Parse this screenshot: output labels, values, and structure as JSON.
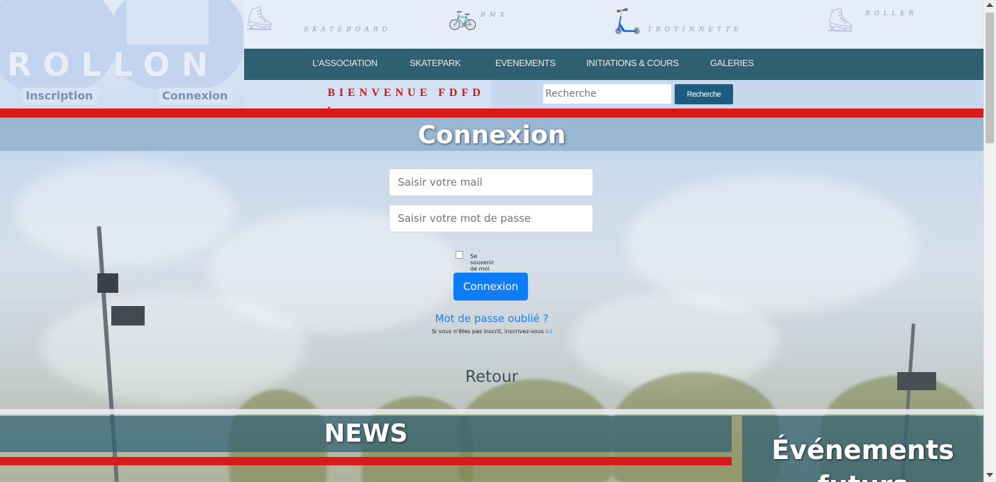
{
  "header": {
    "logo_text": "ROLLON",
    "inscription_label": "Inscription",
    "connexion_label": "Connexion"
  },
  "sports": {
    "skateboard": "SKATEBOARD",
    "bmx": "BMX",
    "trotinnette": "TROTINNETTE",
    "roller": "ROLLER"
  },
  "nav": {
    "items": [
      "L'ASSOCIATION",
      "SKATEPARK",
      "EVENEMENTS",
      "INITIATIONS & COURS",
      "GALERIES"
    ]
  },
  "welcome": {
    "text": "BIENVENUE FDFD ."
  },
  "search": {
    "placeholder": "Recherche",
    "button_label": "Recherche"
  },
  "login": {
    "title": "Connexion",
    "email_placeholder": "Saisir votre mail",
    "password_placeholder": "Saisir votre mot de passe",
    "remember_label": "Se souvenir de moi",
    "remember_checked": false,
    "submit_label": "Connexion",
    "forgot_label": "Mot de passe oublié ?",
    "register_text": "Si vous n'êtes pas inscrit, inscrivez-vous",
    "register_link": "ici",
    "back_label": "Retour"
  },
  "sections": {
    "news_title": "NEWS",
    "events_title_line1": "Événements",
    "events_title_line2": "futurs"
  },
  "colors": {
    "nav_bg": "#2e6072",
    "accent_red": "#d81a1a",
    "primary_button": "#0d7cf6",
    "search_button": "#1d5c7e",
    "welcome_text": "#c11b1b"
  }
}
